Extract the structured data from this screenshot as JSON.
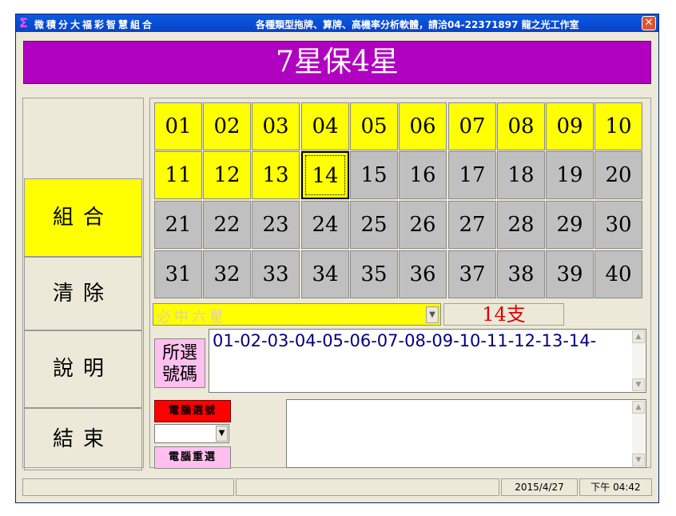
{
  "window": {
    "title": "微積分大福彩智慧組合",
    "ad_text": "各種類型拖牌、算牌、高機率分析軟體，請洽04-22371897 龍之光工作室",
    "close_label": "✕",
    "app_icon": "sigma-icon"
  },
  "header": {
    "title": "7星保4星"
  },
  "sidebar": {
    "items": [
      {
        "label": "組合",
        "active": true
      },
      {
        "label": "清除",
        "active": false
      },
      {
        "label": "說明",
        "active": false
      },
      {
        "label": "結束",
        "active": false
      }
    ]
  },
  "numbers": {
    "cells": [
      "01",
      "02",
      "03",
      "04",
      "05",
      "06",
      "07",
      "08",
      "09",
      "10",
      "11",
      "12",
      "13",
      "14",
      "15",
      "16",
      "17",
      "18",
      "19",
      "20",
      "21",
      "22",
      "23",
      "24",
      "25",
      "26",
      "27",
      "28",
      "29",
      "30",
      "31",
      "32",
      "33",
      "34",
      "35",
      "36",
      "37",
      "38",
      "39",
      "40"
    ],
    "selected_count_of_cells": 14,
    "focused": "14"
  },
  "mode_select": {
    "value": "必中六星"
  },
  "count_display": "14支",
  "selection": {
    "label": "所選號碼",
    "value": "01-02-03-04-05-06-07-08-09-10-11-12-13-14-"
  },
  "actions": {
    "computer_pick": "電腦選號",
    "computer_reselect": "電腦重選"
  },
  "status_bar": {
    "date": "2015/4/27",
    "time": "下午 04:42"
  },
  "colors": {
    "header_bg": "#b000c0",
    "selected": "#ffff00",
    "unselected": "#c0c0c0",
    "count_text": "#e00000",
    "selection_text": "#000080"
  }
}
